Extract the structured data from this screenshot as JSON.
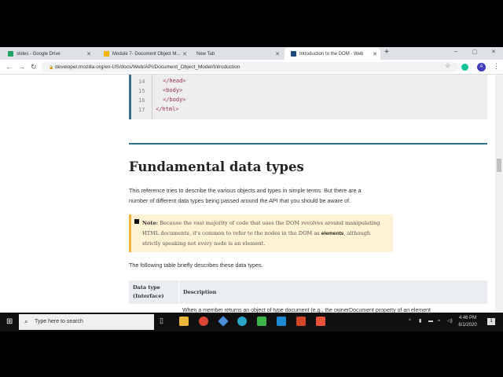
{
  "browser": {
    "tabs": [
      {
        "title": "slides - Google Drive",
        "color": "#f4b400"
      },
      {
        "title": "Module 7- Document Object M...",
        "color": "#f4b400"
      },
      {
        "title": "New Tab",
        "color": "#dee1e6"
      },
      {
        "title": "Introduction to the DOM - Web",
        "color": "#1b4c7a"
      }
    ],
    "new_tab": "+",
    "url": "developer.mozilla.org/en-US/docs/Web/API/Document_Object_Model/Introduction",
    "avatar": "A"
  },
  "code": {
    "lines": [
      {
        "n": "14",
        "t": "</head>",
        "indent": 2
      },
      {
        "n": "15",
        "t": "<body>",
        "indent": 2
      },
      {
        "n": "16",
        "t": "</body>",
        "indent": 2
      },
      {
        "n": "17",
        "t": "</html>",
        "indent": 0
      }
    ]
  },
  "heading": "Fundamental data types",
  "intro_1": "This reference tries to describe the various objects and types in simple terms. But there are a",
  "intro_2": "number of different data types being passed around the API that you should be aware of.",
  "note": {
    "label": "Note:",
    "text_1": " Because the vast majority of code that uses the DOM revolves around manipulating",
    "text_2": "HTML documents, it's common to refer to the nodes in the DOM as ",
    "bold": "elements",
    "text_3": ", although",
    "text_4": "strictly speaking not every node is an element."
  },
  "table_intro": "The following table briefly describes these data types.",
  "table": {
    "col1": "Data type",
    "col1b": "(Interface)",
    "col2": "Description",
    "row1": "When a member returns an object of type document (e.g., the ownerDocument property of an element"
  },
  "taskbar": {
    "search_placeholder": "Type here to search",
    "time": "4:46 PM",
    "date": "6/1/2020",
    "notif": "1"
  }
}
